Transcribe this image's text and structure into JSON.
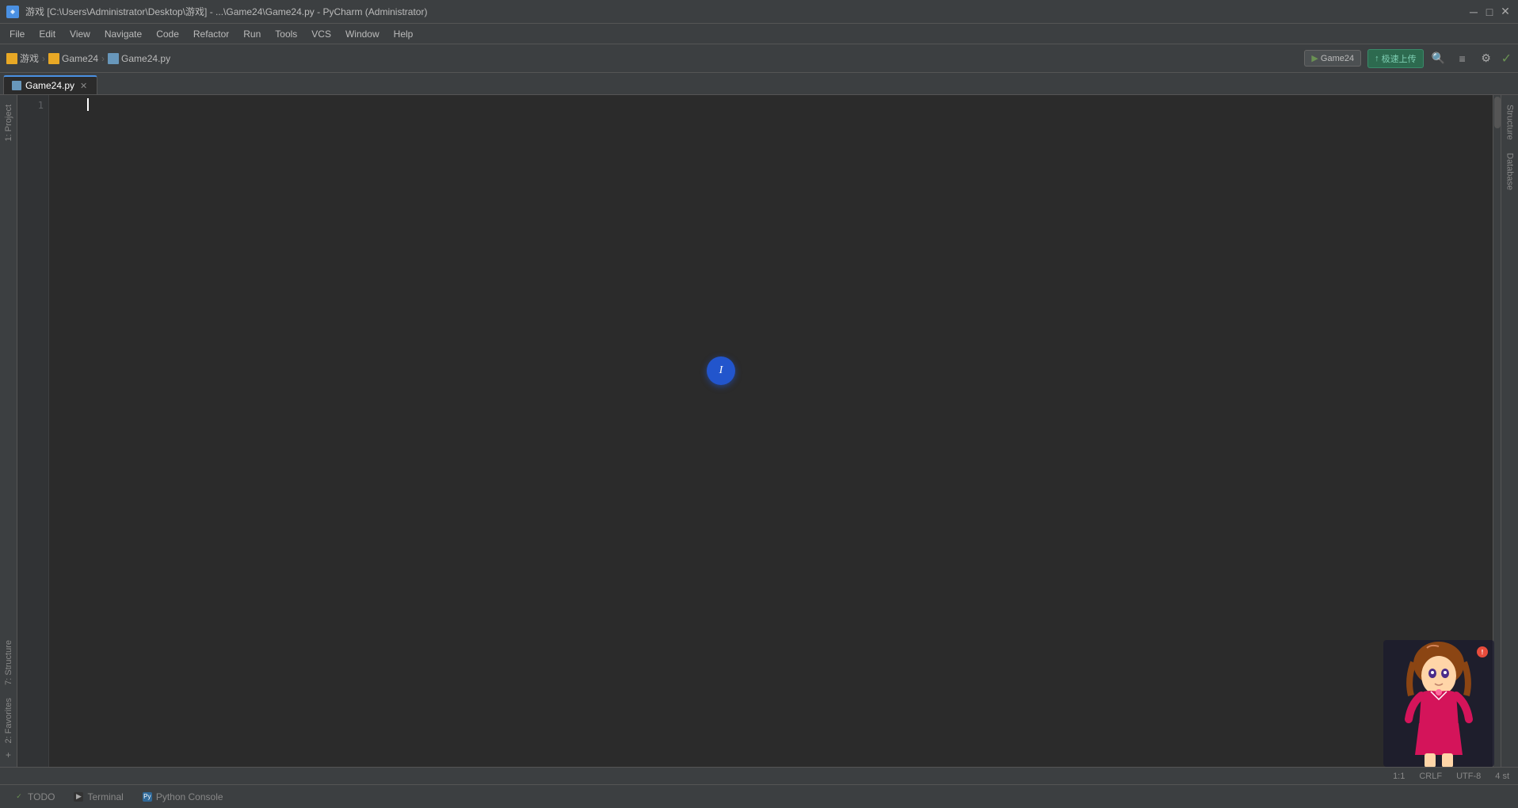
{
  "titlebar": {
    "title": "游戏 [C:\\Users\\Administrator\\Desktop\\游戏] - ...\\Game24\\Game24.py - PyCharm (Administrator)",
    "minimize_label": "─",
    "maximize_label": "□",
    "close_label": "✕"
  },
  "menubar": {
    "items": [
      "File",
      "Edit",
      "View",
      "Navigate",
      "Code",
      "Refactor",
      "Run",
      "Tools",
      "VCS",
      "Window",
      "Help"
    ]
  },
  "toolbar": {
    "breadcrumb": {
      "project": "游戏",
      "folder": "Game24",
      "file": "Game24.py"
    },
    "run_button": "Game24",
    "upload_button": "极速上传",
    "check_icon": "✓"
  },
  "tabs": {
    "active_tab": "Game24.py",
    "items": [
      {
        "label": "Game24.py",
        "active": true,
        "closeable": true
      }
    ]
  },
  "editor": {
    "line_numbers": [
      "1"
    ],
    "content": "",
    "cursor_visible": true
  },
  "left_panel": {
    "tabs": [
      {
        "label": "1: Project",
        "active": false
      },
      {
        "label": "2: Favorites",
        "active": false
      }
    ]
  },
  "right_panel": {
    "tabs": [
      {
        "label": "Structure",
        "active": false
      },
      {
        "label": "Database",
        "active": false
      }
    ]
  },
  "bottom_toolbar": {
    "tabs": [
      {
        "label": "TODO",
        "active": false,
        "icon": "✓"
      },
      {
        "label": "Terminal",
        "active": false,
        "icon": ">"
      },
      {
        "label": "Python Console",
        "active": false,
        "icon": "🐍"
      }
    ]
  },
  "status_bar": {
    "left": "",
    "encoding": "UTF-8",
    "line_separator": "CRLF",
    "position": "1:1",
    "spaces": "4 st"
  },
  "blue_circle": {
    "symbol": "I"
  }
}
